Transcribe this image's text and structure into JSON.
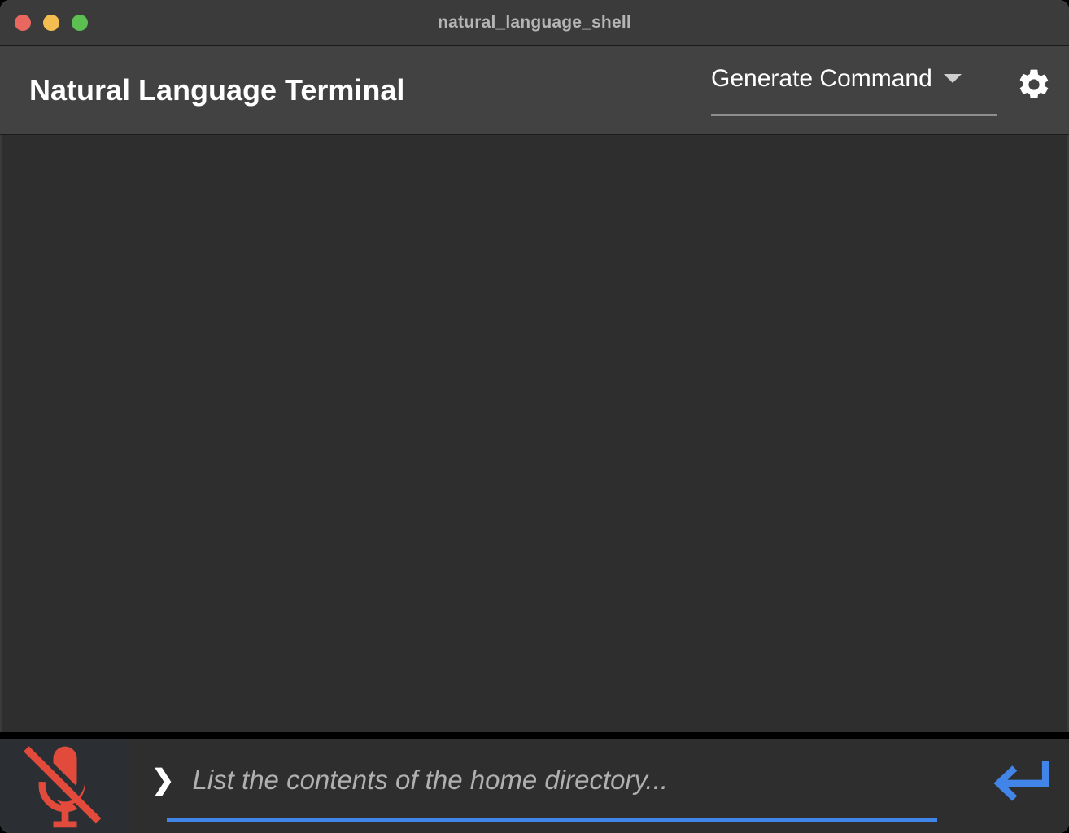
{
  "window": {
    "title": "natural_language_shell",
    "controls": [
      {
        "name": "close",
        "color": "#e8685f"
      },
      {
        "name": "minimize",
        "color": "#f4bd4f"
      },
      {
        "name": "zoom",
        "color": "#5cbf52"
      }
    ]
  },
  "header": {
    "app_title": "Natural Language Terminal",
    "mode_select": {
      "selected": "Generate Command",
      "options": [
        "Generate Command"
      ],
      "caret_icon": "chevron-down-icon"
    },
    "settings_icon": "gear-icon"
  },
  "terminal": {
    "output": "",
    "background": "#2e2e2e"
  },
  "input_bar": {
    "mic": {
      "icon": "microphone-off-icon",
      "state": "muted",
      "color": "#e24b3c"
    },
    "prompt_symbol": "❯",
    "value": "",
    "placeholder": "List the contents of the home directory...",
    "underline_color": "#4285e8",
    "submit": {
      "icon": "enter-return-arrow-icon",
      "color": "#4285e8"
    }
  }
}
